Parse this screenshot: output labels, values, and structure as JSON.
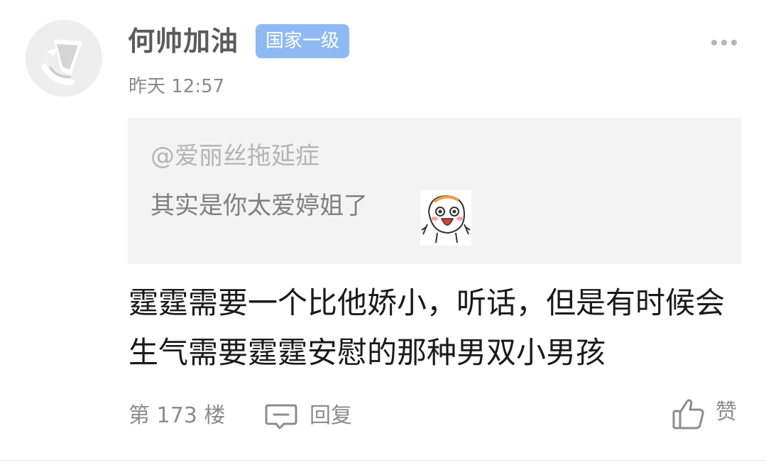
{
  "user": {
    "name": "何帅加油",
    "badge": "国家一级",
    "timestamp": "昨天 12:57"
  },
  "quote": {
    "author": "@爱丽丝拖延症",
    "text": "其实是你太爱婷姐了"
  },
  "comment": {
    "text": "霆霆需要一个比他娇小，听话，但是有时候会生气需要霆霆安慰的那种男双小男孩"
  },
  "footer": {
    "floor": "第 173 楼",
    "reply_label": "回复",
    "like_label": "赞"
  },
  "colors": {
    "badge_bg": "#8fb9f2",
    "quote_bg": "#f3f3f3",
    "secondary_text": "#8c8c8c"
  },
  "icons": {
    "more": "more-dots-icon",
    "reply": "comment-bubble-icon",
    "like": "thumbs-up-icon",
    "sticker": "laughing-emoji-sticker"
  }
}
